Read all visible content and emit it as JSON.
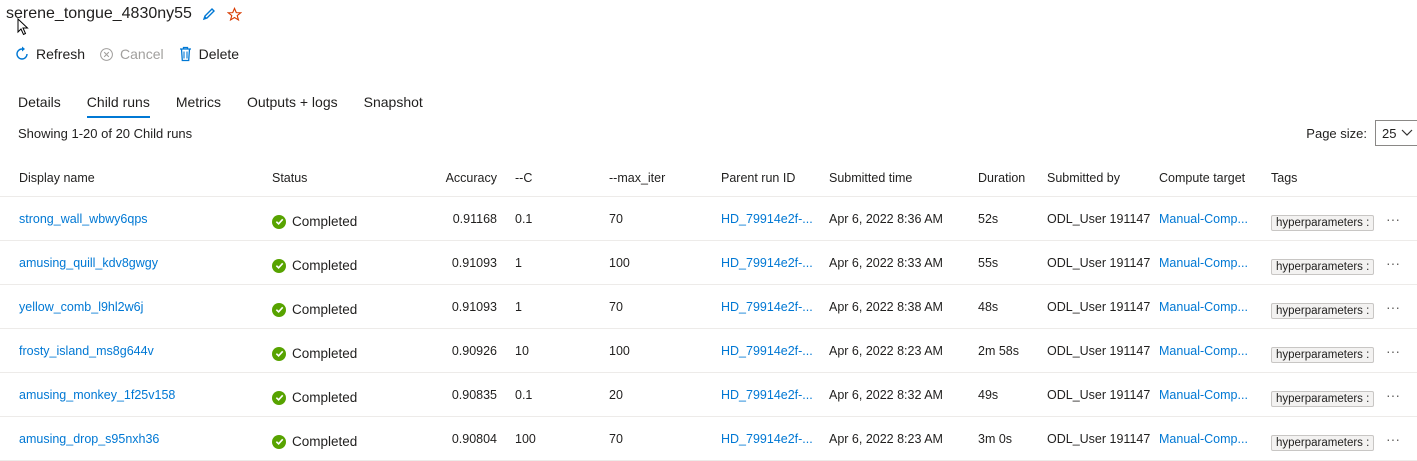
{
  "header": {
    "title": "serene_tongue_4830ny55"
  },
  "toolbar": {
    "refresh": "Refresh",
    "cancel": "Cancel",
    "delete": "Delete"
  },
  "tabs": [
    "Details",
    "Child runs",
    "Metrics",
    "Outputs + logs",
    "Snapshot"
  ],
  "summary": {
    "showing": "Showing 1-20 of 20 Child runs"
  },
  "pagesize": {
    "label": "Page size:",
    "value": "25"
  },
  "table": {
    "columns": [
      "Display name",
      "Status",
      "Accuracy",
      "--C",
      "--max_iter",
      "Parent run ID",
      "Submitted time",
      "Duration",
      "Submitted by",
      "Compute target",
      "Tags"
    ],
    "rows": [
      {
        "name": "strong_wall_wbwy6qps",
        "status": "Completed",
        "accuracy": "0.91168",
        "c": "0.1",
        "max_iter": "70",
        "parent": "HD_79914e2f-...",
        "time": "Apr 6, 2022 8:36 AM",
        "duration": "52s",
        "by": "ODL_User 191147",
        "compute": "Manual-Comp...",
        "tag": "hyperparameters :"
      },
      {
        "name": "amusing_quill_kdv8gwgy",
        "status": "Completed",
        "accuracy": "0.91093",
        "c": "1",
        "max_iter": "100",
        "parent": "HD_79914e2f-...",
        "time": "Apr 6, 2022 8:33 AM",
        "duration": "55s",
        "by": "ODL_User 191147",
        "compute": "Manual-Comp...",
        "tag": "hyperparameters :"
      },
      {
        "name": "yellow_comb_l9hl2w6j",
        "status": "Completed",
        "accuracy": "0.91093",
        "c": "1",
        "max_iter": "70",
        "parent": "HD_79914e2f-...",
        "time": "Apr 6, 2022 8:38 AM",
        "duration": "48s",
        "by": "ODL_User 191147",
        "compute": "Manual-Comp...",
        "tag": "hyperparameters :"
      },
      {
        "name": "frosty_island_ms8g644v",
        "status": "Completed",
        "accuracy": "0.90926",
        "c": "10",
        "max_iter": "100",
        "parent": "HD_79914e2f-...",
        "time": "Apr 6, 2022 8:23 AM",
        "duration": "2m 58s",
        "by": "ODL_User 191147",
        "compute": "Manual-Comp...",
        "tag": "hyperparameters :"
      },
      {
        "name": "amusing_monkey_1f25v158",
        "status": "Completed",
        "accuracy": "0.90835",
        "c": "0.1",
        "max_iter": "20",
        "parent": "HD_79914e2f-...",
        "time": "Apr 6, 2022 8:32 AM",
        "duration": "49s",
        "by": "ODL_User 191147",
        "compute": "Manual-Comp...",
        "tag": "hyperparameters :"
      },
      {
        "name": "amusing_drop_s95nxh36",
        "status": "Completed",
        "accuracy": "0.90804",
        "c": "100",
        "max_iter": "70",
        "parent": "HD_79914e2f-...",
        "time": "Apr 6, 2022 8:23 AM",
        "duration": "3m 0s",
        "by": "ODL_User 191147",
        "compute": "Manual-Comp...",
        "tag": "hyperparameters :"
      }
    ],
    "more_glyph": "···"
  },
  "colors": {
    "accent": "#0078d4",
    "success": "#57a300",
    "star": "#d83b01"
  }
}
